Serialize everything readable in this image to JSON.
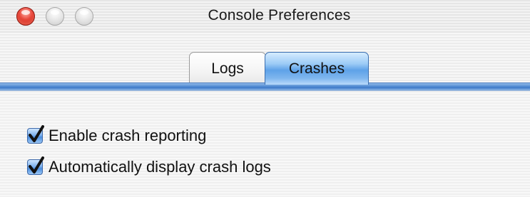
{
  "window": {
    "title": "Console Preferences"
  },
  "tabs": [
    {
      "label": "Logs",
      "selected": false
    },
    {
      "label": "Crashes",
      "selected": true
    }
  ],
  "options": [
    {
      "label": "Enable crash reporting",
      "checked": true
    },
    {
      "label": "Automatically display crash logs",
      "checked": true
    }
  ],
  "colors": {
    "accent": "#5ea2e8",
    "close_button": "#e8463a",
    "checkmark": "#111111"
  },
  "icons": {
    "close": "close-button-icon",
    "minimize": "minimize-button-icon",
    "zoom": "zoom-button-icon",
    "check": "checkmark-icon"
  }
}
